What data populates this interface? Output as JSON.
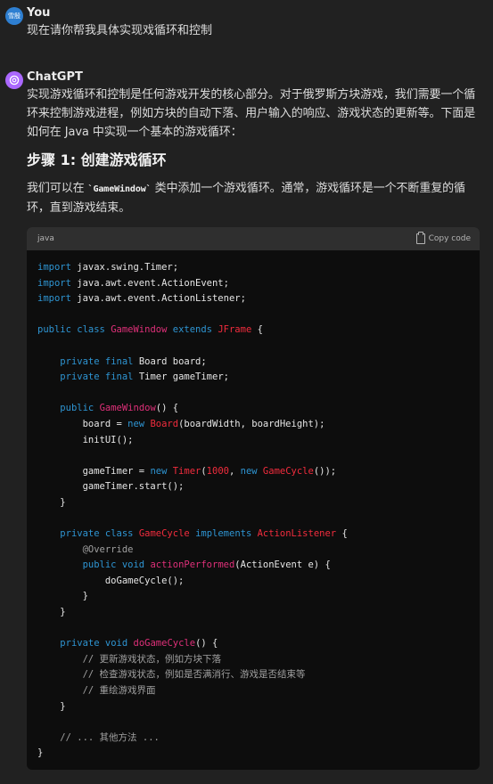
{
  "user": {
    "avatar_text": "雪殷",
    "author": "You",
    "message": "现在请你帮我具体实现戏循环和控制"
  },
  "assistant": {
    "author": "ChatGPT",
    "intro": "实现游戏循环和控制是任何游戏开发的核心部分。对于俄罗斯方块游戏，我们需要一个循环来控制游戏进程，例如方块的自动下落、用户输入的响应、游戏状态的更新等。下面是如何在 Java 中实现一个基本的游戏循环：",
    "step_title": "步骤 1: 创建游戏循环",
    "step_text_before": "我们可以在 ",
    "step_code": "`GameWindow`",
    "step_text_after": " 类中添加一个游戏循环。通常，游戏循环是一个不断重复的循环，直到游戏结束。",
    "code_block": {
      "language": "java",
      "copy_label": "Copy code",
      "lines": [
        "import javax.swing.Timer;",
        "import java.awt.event.ActionEvent;",
        "import java.awt.event.ActionListener;",
        "",
        "public class GameWindow extends JFrame {",
        "",
        "    private final Board board;",
        "    private final Timer gameTimer;",
        "",
        "    public GameWindow() {",
        "        board = new Board(boardWidth, boardHeight);",
        "        initUI();",
        "",
        "        gameTimer = new Timer(1000, new GameCycle());",
        "        gameTimer.start();",
        "    }",
        "",
        "    private class GameCycle implements ActionListener {",
        "        @Override",
        "        public void actionPerformed(ActionEvent e) {",
        "            doGameCycle();",
        "        }",
        "    }",
        "",
        "    private void doGameCycle() {",
        "        // 更新游戏状态，例如方块下落",
        "        // 检查游戏状态，例如是否满消行、游戏是否结束等",
        "        // 重绘游戏界面",
        "    }",
        "",
        "    // ... 其他方法 ...",
        "}"
      ]
    }
  }
}
